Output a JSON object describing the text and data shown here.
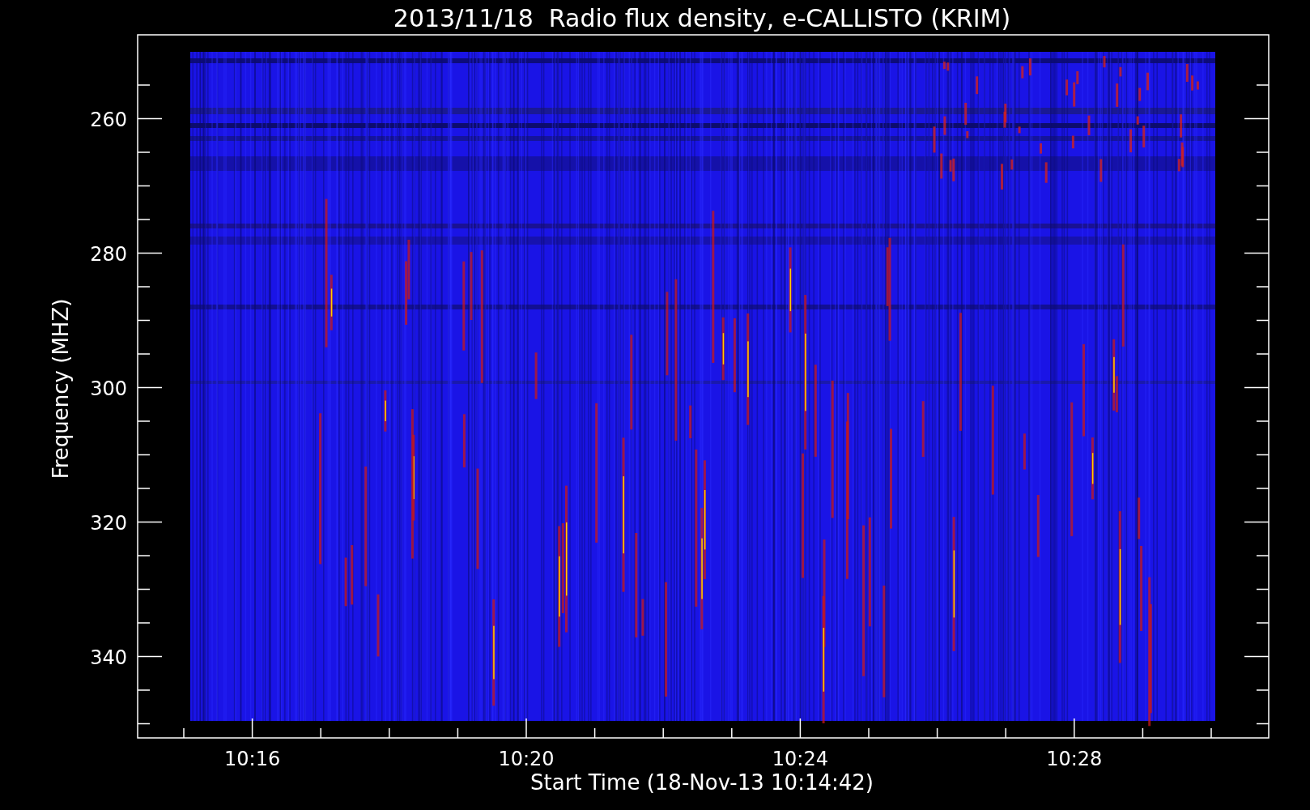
{
  "title": "2013/11/18  Radio flux density, e-CALLISTO (KRIM)",
  "plot": {
    "ylabel": "Frequency (MHZ)",
    "xlabel": "Start Time (18-Nov-13 10:14:42)",
    "yticks": [
      "260",
      "280",
      "300",
      "320",
      "340"
    ],
    "xticks": [
      "10:16",
      "10:20",
      "10:24",
      "10:28"
    ]
  }
}
